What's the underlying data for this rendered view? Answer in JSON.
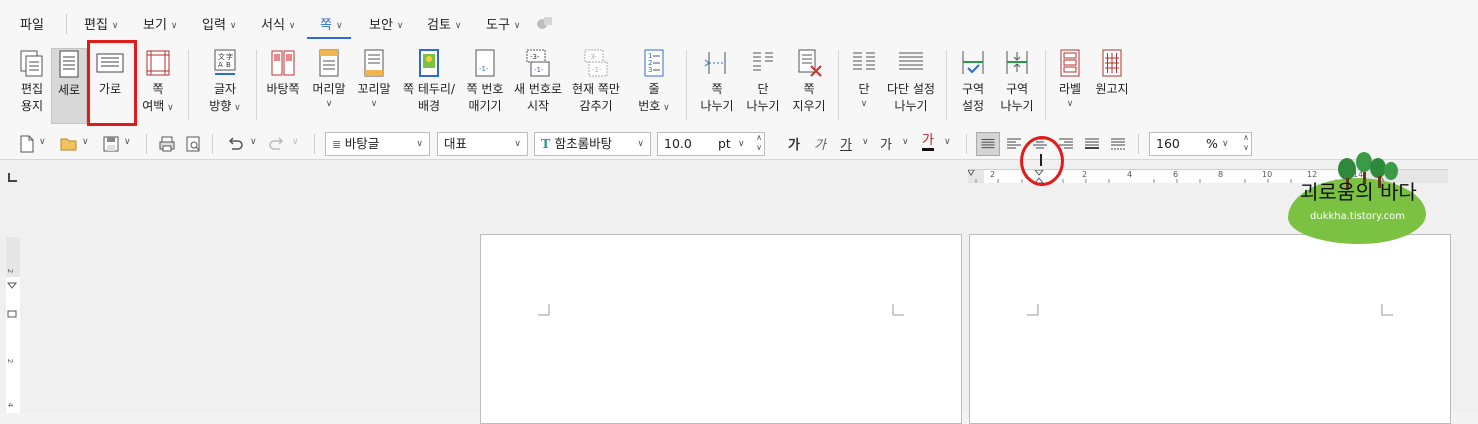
{
  "menu": {
    "file": "파일",
    "edit": "편집",
    "view": "보기",
    "input": "입력",
    "format": "서식",
    "page": "쪽",
    "security": "보안",
    "review": "검토",
    "tools": "도구"
  },
  "ribbon": {
    "edit_paper": [
      "편집",
      "용지"
    ],
    "portrait": "세로",
    "landscape": "가로",
    "page_margin": [
      "쪽",
      "여백"
    ],
    "text_direction": [
      "글자",
      "방향"
    ],
    "background_page": "바탕쪽",
    "header": "머리말",
    "footer": "꼬리말",
    "page_border": [
      "쪽 테두리/",
      "배경"
    ],
    "page_number": [
      "쪽 번호",
      "매기기"
    ],
    "new_number": [
      "새 번호로",
      "시작"
    ],
    "hide_current_page": [
      "현재 쪽만",
      "감추기"
    ],
    "line_number": [
      "줄",
      "번호"
    ],
    "page_break": [
      "쪽",
      "나누기"
    ],
    "column_break": [
      "단",
      "나누기"
    ],
    "delete_page": [
      "쪽",
      "지우기"
    ],
    "columns": "단",
    "multi_column_break": [
      "다단 설정",
      "나누기"
    ],
    "section_settings": [
      "구역",
      "설정"
    ],
    "section_break": [
      "구역",
      "나누기"
    ],
    "label": "라벨",
    "manuscript": "원고지"
  },
  "toolbar": {
    "style": "바탕글",
    "font_group": "대표",
    "font": "함초롬바탕",
    "font_size": "10.0",
    "font_unit": "pt",
    "bold": "가",
    "italic": "가",
    "underline": "가",
    "strike": "가",
    "font_color": "가",
    "zoom": "160",
    "zoom_unit": "%"
  },
  "ruler": {
    "h_numbers": [
      "2",
      "2",
      "4",
      "6",
      "8",
      "10",
      "12",
      "14",
      "16"
    ],
    "v_numbers": [
      "2",
      "2",
      "4"
    ]
  },
  "watermark": {
    "title": "괴로움의 바다",
    "url": "dukkha.tistory.com"
  },
  "colors": {
    "accent": "#2d6cd8",
    "annotation_red": "#e11a1a",
    "watermark_green": "#7bc142"
  }
}
